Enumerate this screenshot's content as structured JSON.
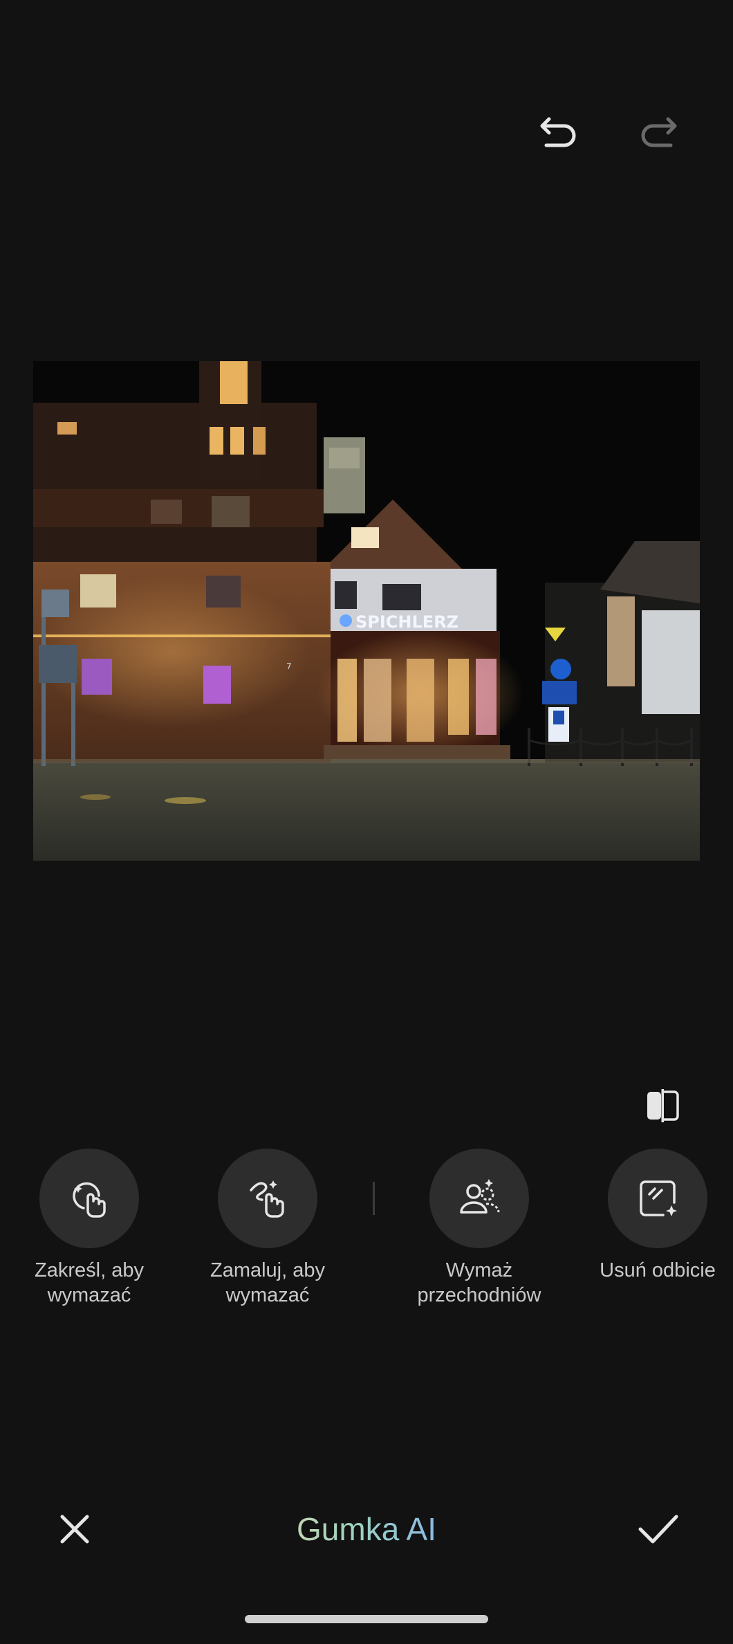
{
  "toolbar": {
    "undo_icon": "undo-icon",
    "redo_icon": "redo-icon",
    "redo_enabled": false
  },
  "photo": {
    "sign_text": "SPICHLERZ",
    "house_number": "7"
  },
  "compare_icon": "compare-icon",
  "tools": [
    {
      "label": "Zakreśl, aby\nwymazać",
      "icon": "circle-select-icon"
    },
    {
      "label": "Zamaluj, aby\nwymazać",
      "icon": "brush-erase-icon"
    },
    {
      "label": "Wymaż\nprzechodniów",
      "icon": "remove-people-icon"
    },
    {
      "label": "Usuń odbicie",
      "icon": "remove-reflection-icon"
    }
  ],
  "footer": {
    "title": "Gumka AI",
    "cancel_icon": "close-icon",
    "confirm_icon": "check-icon"
  },
  "colors": {
    "background": "#121212",
    "tool_circle": "#2d2d2d",
    "title_gradient": [
      "#f0d9a8",
      "#9ed3c0",
      "#7aa6ff"
    ]
  }
}
